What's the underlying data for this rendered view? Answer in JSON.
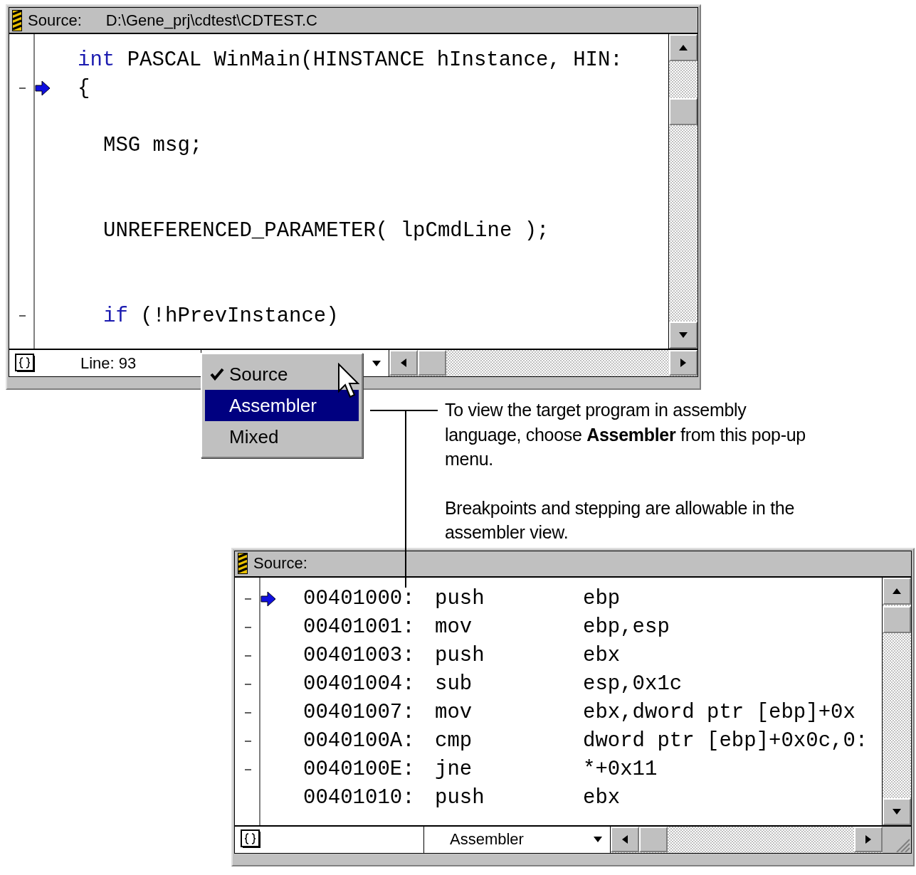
{
  "source_window": {
    "title_label": "Source:",
    "file_path": "D:\\Gene_prj\\cdtest\\CDTEST.C",
    "lines": [
      {
        "kind": "code",
        "keyword": "int",
        "text": "PASCAL WinMain(HINSTANCE hInstance, HIN:",
        "marker": false,
        "current": false
      },
      {
        "kind": "code",
        "text": "{",
        "marker": true,
        "current": true,
        "children": [
          {
            "kind": "blank"
          },
          {
            "kind": "code",
            "text": "MSG msg;",
            "marker": false,
            "current": false
          },
          {
            "kind": "blank"
          },
          {
            "kind": "blank"
          },
          {
            "kind": "code",
            "text": "UNREFERENCED_PARAMETER( lpCmdLine );",
            "marker": false,
            "current": false
          },
          {
            "kind": "blank"
          },
          {
            "kind": "blank"
          },
          {
            "kind": "code",
            "keyword": "if",
            "text": "(!hPrevInstance)",
            "marker": true,
            "current": false
          }
        ]
      }
    ],
    "status_line": "Line: 93"
  },
  "view_menu": {
    "items": [
      {
        "label": "Source",
        "checked": true,
        "selected": false
      },
      {
        "label": "Assembler",
        "checked": false,
        "selected": true
      },
      {
        "label": "Mixed",
        "checked": false,
        "selected": false
      }
    ]
  },
  "callout": {
    "paragraphs": [
      "To view the target program in assembly language, choose **Assembler** from this pop-up menu.",
      "Breakpoints and stepping are allowable in the assembler view."
    ]
  },
  "assembler_window": {
    "title_label": "Source:",
    "rows": [
      {
        "address": "00401000:",
        "mnemonic": "push",
        "operand": "ebp",
        "marker": true,
        "current": true
      },
      {
        "address": "00401001:",
        "mnemonic": "mov",
        "operand": "ebp,esp",
        "marker": true,
        "current": false
      },
      {
        "address": "00401003:",
        "mnemonic": "push",
        "operand": "ebx",
        "marker": true,
        "current": false
      },
      {
        "address": "00401004:",
        "mnemonic": "sub",
        "operand": "esp,0x1c",
        "marker": true,
        "current": false
      },
      {
        "address": "00401007:",
        "mnemonic": "mov",
        "operand": "ebx,dword ptr [ebp]+0x",
        "marker": true,
        "current": false
      },
      {
        "address": "0040100A:",
        "mnemonic": "cmp",
        "operand": "dword ptr [ebp]+0x0c,0:",
        "marker": true,
        "current": false
      },
      {
        "address": "0040100E:",
        "mnemonic": "jne",
        "operand": "*+0x11",
        "marker": true,
        "current": false
      },
      {
        "address": "00401010:",
        "mnemonic": "push",
        "operand": "ebx",
        "marker": false,
        "current": false
      }
    ],
    "view_dropdown": "Assembler"
  }
}
